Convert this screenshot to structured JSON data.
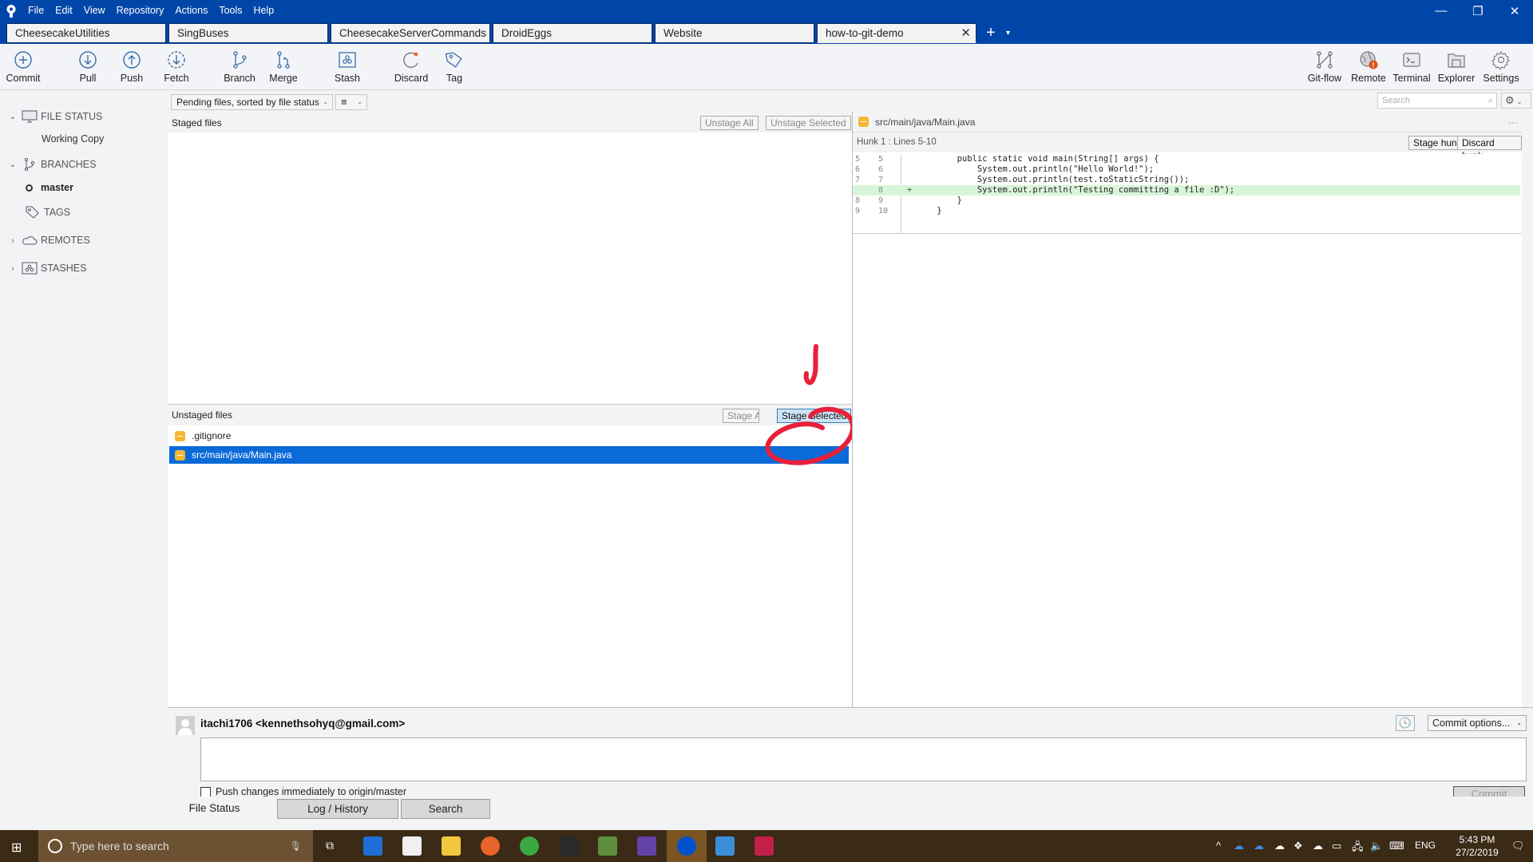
{
  "app": {
    "menu": [
      "File",
      "Edit",
      "View",
      "Repository",
      "Actions",
      "Tools",
      "Help"
    ],
    "window_controls": {
      "minimize": "—",
      "restore": "❐",
      "close": "✕"
    }
  },
  "tabs": [
    {
      "label": "CheesecakeUtilities",
      "active": false
    },
    {
      "label": "SingBuses",
      "active": false
    },
    {
      "label": "CheesecakeServerCommands",
      "active": false
    },
    {
      "label": "DroidEggs",
      "active": false
    },
    {
      "label": "Website",
      "active": false
    },
    {
      "label": "how-to-git-demo",
      "active": true
    }
  ],
  "tab_close": "✕",
  "tab_add": "+",
  "tab_more": "▾",
  "toolbar": {
    "left": [
      {
        "label": "Commit",
        "icon": "commit-icon"
      },
      {
        "label": "Pull",
        "icon": "pull-icon"
      },
      {
        "label": "Push",
        "icon": "push-icon"
      },
      {
        "label": "Fetch",
        "icon": "fetch-icon"
      },
      {
        "label": "Branch",
        "icon": "branch-icon"
      },
      {
        "label": "Merge",
        "icon": "merge-icon"
      },
      {
        "label": "Stash",
        "icon": "stash-icon"
      },
      {
        "label": "Discard",
        "icon": "discard-icon"
      },
      {
        "label": "Tag",
        "icon": "tag-icon"
      }
    ],
    "right": [
      {
        "label": "Git-flow",
        "icon": "git-flow-icon"
      },
      {
        "label": "Remote",
        "icon": "remote-icon",
        "badge": "!"
      },
      {
        "label": "Terminal",
        "icon": "terminal-icon"
      },
      {
        "label": "Explorer",
        "icon": "explorer-icon"
      },
      {
        "label": "Settings",
        "icon": "settings-icon"
      }
    ],
    "search_placeholder": "Search"
  },
  "sidebar": {
    "file_status": "FILE STATUS",
    "working_copy": "Working Copy",
    "branches": "BRANCHES",
    "current_branch": "master",
    "tags": "TAGS",
    "remotes": "REMOTES",
    "stashes": "STASHES"
  },
  "filter": {
    "view_mode": "Pending files, sorted by file status"
  },
  "staged": {
    "title": "Staged files",
    "unstage_all": "Unstage All",
    "unstage_selected": "Unstage Selected",
    "files": []
  },
  "unstaged": {
    "title": "Unstaged files",
    "stage_all": "Stage All",
    "stage_selected": "Stage Selected",
    "files": [
      {
        "name": ".gitignore",
        "status": "modified",
        "selected": false
      },
      {
        "name": "src/main/java/Main.java",
        "status": "modified",
        "selected": true
      }
    ]
  },
  "diff": {
    "file": "src/main/java/Main.java",
    "more": "···",
    "hunk_title": "Hunk 1 : Lines 5-10",
    "stage_hunk": "Stage hunk",
    "discard_hunk": "Discard hunk",
    "lines": [
      {
        "old": "5",
        "new": "5",
        "marker": "",
        "text": "        public static void main(String[] args) {",
        "added": false
      },
      {
        "old": "6",
        "new": "6",
        "marker": "",
        "text": "            System.out.println(\"Hello World!\");",
        "added": false
      },
      {
        "old": "7",
        "new": "7",
        "marker": "",
        "text": "            System.out.println(test.toStaticString());",
        "added": false
      },
      {
        "old": "",
        "new": "8",
        "marker": "+",
        "text": "            System.out.println(\"Testing committing a file :D\");",
        "added": true
      },
      {
        "old": "8",
        "new": "9",
        "marker": "",
        "text": "        }",
        "added": false
      },
      {
        "old": "9",
        "new": "10",
        "marker": "",
        "text": "    }",
        "added": false
      }
    ]
  },
  "commit": {
    "author": "itachi1706 <kennethsohyq@gmail.com>",
    "message": "",
    "push_immediately": "Push changes immediately to origin/master",
    "push_checked": false,
    "options": "Commit options...",
    "commit_button": "Commit"
  },
  "bottom_tabs": [
    {
      "label": "File Status",
      "active": true
    },
    {
      "label": "Log / History",
      "active": false
    },
    {
      "label": "Search",
      "active": false
    }
  ],
  "taskbar": {
    "search_placeholder": "Type here to search",
    "language": "ENG",
    "time": "5:43 PM",
    "date": "27/2/2019"
  },
  "colors": {
    "titlebar": "#0046a8",
    "selection": "#0a6ad8",
    "added_line": "#d9f5d9",
    "file_modified": "#f5b731",
    "annotation": "#e8203a"
  }
}
